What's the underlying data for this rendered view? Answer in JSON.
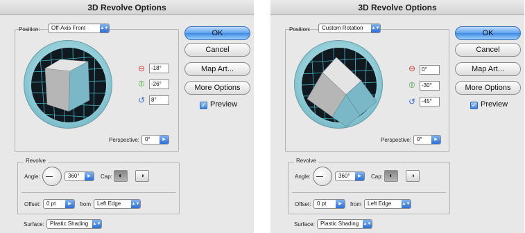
{
  "dialogs": [
    {
      "title": "3D Revolve Options",
      "position_label": "Position:",
      "position_value": "Off-Axis Front",
      "rotation_x": "-18°",
      "rotation_y": "-26°",
      "rotation_z": "8°",
      "perspective_label": "Perspective:",
      "perspective_value": "0°",
      "buttons": {
        "ok": "OK",
        "cancel": "Cancel",
        "map_art": "Map Art...",
        "more_options": "More Options"
      },
      "preview_label": "Preview",
      "revolve_title": "Revolve",
      "angle_label": "Angle:",
      "angle_value": "360°",
      "cap_label": "Cap:",
      "offset_label": "Offset:",
      "offset_value": "0 pt",
      "from_label": "from",
      "from_value": "Left Edge",
      "surface_label": "Surface:",
      "surface_value": "Plastic Shading"
    },
    {
      "title": "3D Revolve Options",
      "position_label": "Position:",
      "position_value": "Custom Rotation",
      "rotation_x": "0°",
      "rotation_y": "-30°",
      "rotation_z": "-45°",
      "perspective_label": "Perspective:",
      "perspective_value": "0°",
      "buttons": {
        "ok": "OK",
        "cancel": "Cancel",
        "map_art": "Map Art...",
        "more_options": "More Options"
      },
      "preview_label": "Preview",
      "revolve_title": "Revolve",
      "angle_label": "Angle:",
      "angle_value": "360°",
      "cap_label": "Cap:",
      "offset_label": "Offset:",
      "offset_value": "0 pt",
      "from_label": "from",
      "from_value": "Left Edge",
      "surface_label": "Surface:",
      "surface_value": "Plastic Shading"
    }
  ],
  "icons": {
    "rotate_x": "x-axis-rotate-icon",
    "rotate_y": "y-axis-rotate-icon",
    "rotate_z": "z-axis-rotate-icon",
    "cap_on": "cap-on-icon",
    "cap_off": "cap-off-icon",
    "checkmark": "checkmark-icon"
  },
  "colors": {
    "ok_button": "#5ea2ee",
    "cube_face": "#7ab8c8",
    "trackball_grid": "#4fd8e6",
    "rotate_x_icon": "#d43a3a",
    "rotate_y_icon": "#3aa43a",
    "rotate_z_icon": "#3a6ad4"
  }
}
